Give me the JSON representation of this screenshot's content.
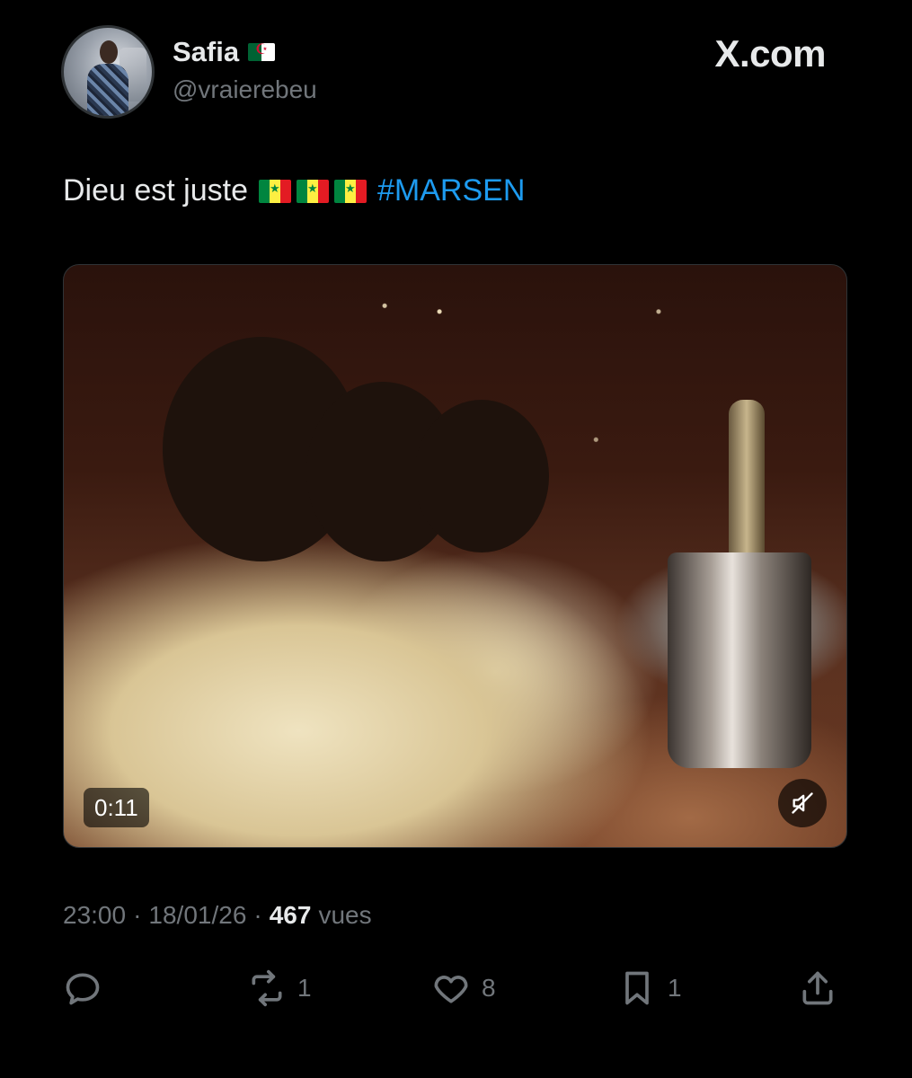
{
  "user": {
    "display_name": "Safia",
    "flag_emoji": "algeria-flag",
    "handle": "@vraierebeu"
  },
  "brand": "X.com",
  "tweet": {
    "text": "Dieu est juste",
    "emojis": [
      "senegal-flag",
      "senegal-flag",
      "senegal-flag"
    ],
    "hashtag": "#MARSEN"
  },
  "media": {
    "duration": "0:11",
    "muted": true
  },
  "meta": {
    "time": "23:00",
    "separator": "·",
    "date": "18/01/26",
    "views_count": "467",
    "views_label": "vues"
  },
  "actions": {
    "reply_count": "",
    "retweet_count": "1",
    "like_count": "8",
    "bookmark_count": "1"
  },
  "colors": {
    "background": "#000000",
    "text": "#e7e9ea",
    "muted_text": "#71767b",
    "link": "#1d9bf0"
  }
}
